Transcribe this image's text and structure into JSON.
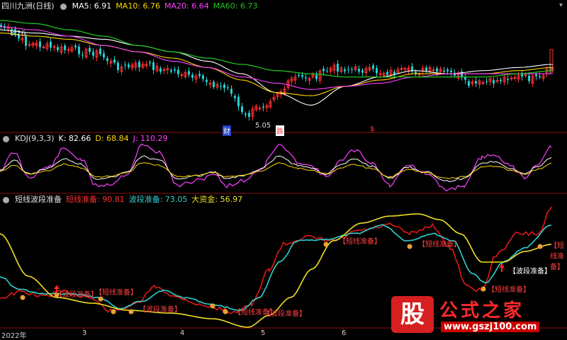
{
  "header_main": {
    "title": "四川九洲(日线)",
    "ma5_label": "MA5: 6.91",
    "ma10_label": "MA10: 6.76",
    "ma20_label": "MA20: 6.64",
    "ma60_label": "MA60: 6.73"
  },
  "header_kdj": {
    "title": "KDJ(9,3,3)",
    "k_label": "K: 82.66",
    "d_label": "D: 68.84",
    "j_label": "J: 110.29"
  },
  "header_ind": {
    "title": "短线波段准备",
    "s1_label": "短线准备: 90.81",
    "s2_label": "波段准备: 73.05",
    "s3_label": "大资金: 56.97"
  },
  "main_chart": {
    "high_label": "8.26",
    "low_label": "5.05",
    "event_1": "财",
    "event_2": "跌",
    "event_3": "$"
  },
  "annotations": {
    "short_ready": "【短线准备】",
    "band_ready": "【波段准备】"
  },
  "dates": [
    "2022年",
    "3",
    "4",
    "5",
    "6"
  ],
  "watermark": {
    "badge": "股",
    "title": "公式之家",
    "url": "www.gszj100.com"
  },
  "colors": {
    "up": "#ff3030",
    "down": "#22d0d0",
    "ma5": "#ffffff",
    "ma10": "#ffd700",
    "ma20": "#ff40ff",
    "ma60": "#20c020",
    "short_line": "#e01818",
    "band_line": "#30d0d0",
    "fund_line": "#f0e020"
  },
  "icons": [
    "close-icon"
  ],
  "chart_data": {
    "type": "line",
    "series": [
      {
        "name": "MA5",
        "values": [
          8.0,
          7.9,
          7.8,
          7.7,
          7.5,
          7.3,
          7.0,
          6.6,
          6.0,
          5.6,
          6.2,
          6.5,
          6.7,
          6.6,
          6.7,
          6.8,
          6.9
        ]
      },
      {
        "name": "MA10",
        "values": [
          7.9,
          7.8,
          7.7,
          7.5,
          7.3,
          7.1,
          6.8,
          6.4,
          6.0,
          5.9,
          6.2,
          6.4,
          6.6,
          6.6,
          6.6,
          6.7,
          6.8
        ]
      },
      {
        "name": "MA20",
        "values": [
          8.1,
          8.0,
          7.8,
          7.5,
          7.3,
          7.0,
          6.8,
          6.5,
          6.3,
          6.1,
          6.2,
          6.3,
          6.5,
          6.6,
          6.6,
          6.6,
          6.6
        ]
      },
      {
        "name": "MA60",
        "values": [
          8.3,
          8.2,
          8.0,
          7.8,
          7.5,
          7.3,
          7.1,
          6.9,
          6.7,
          6.6,
          6.5,
          6.5,
          6.5,
          6.5,
          6.5,
          6.6,
          6.7
        ]
      }
    ]
  }
}
